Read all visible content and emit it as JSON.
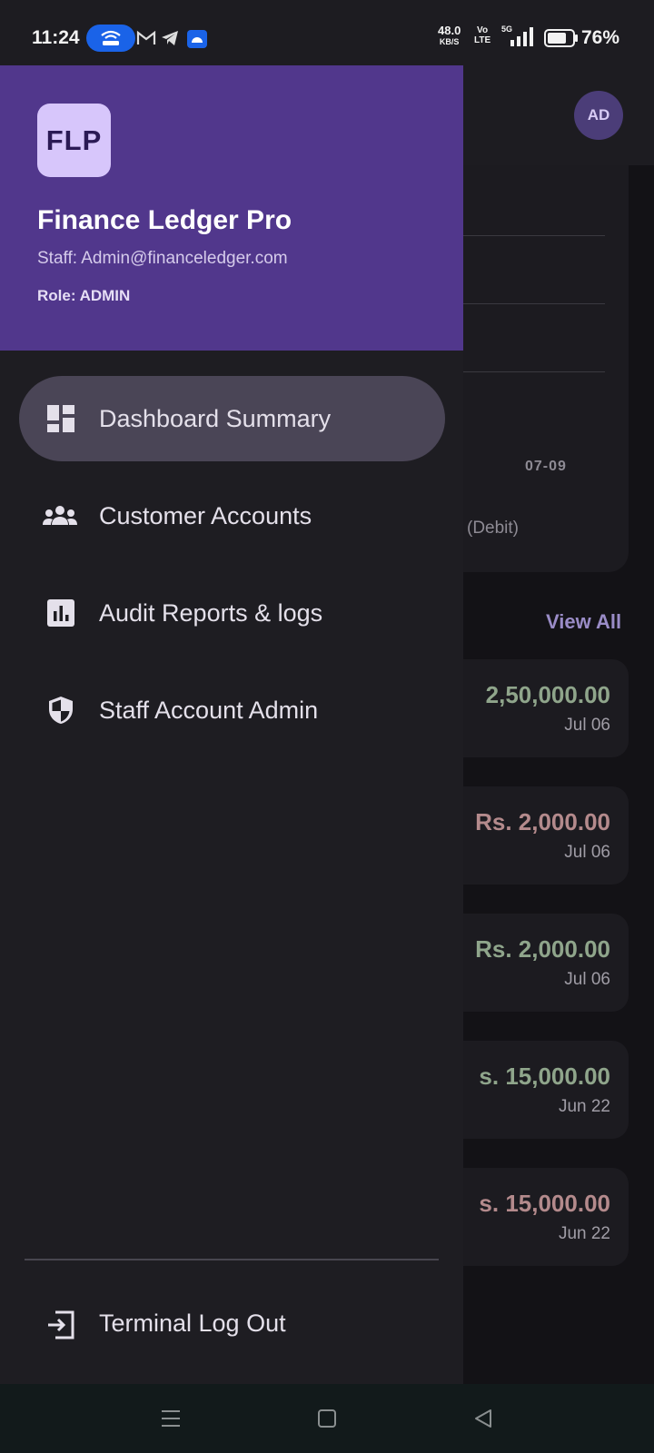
{
  "status_bar": {
    "time": "11:24",
    "net_speed_value": "48.0",
    "net_speed_unit": "KB/S",
    "volte_top": "Vo",
    "volte_bottom": "LTE",
    "network_type": "5G",
    "battery_percent": "76%"
  },
  "drawer": {
    "logo_text": "FLP",
    "app_name": "Finance Ledger Pro",
    "staff_line": "Staff: Admin@financeledger.com",
    "role_line": "Role: ADMIN",
    "nav_items": [
      {
        "label": "Dashboard Summary",
        "icon": "dashboard-icon",
        "active": true
      },
      {
        "label": "Customer Accounts",
        "icon": "group-icon",
        "active": false
      },
      {
        "label": "Audit Reports & logs",
        "icon": "bar-chart-icon",
        "active": false
      },
      {
        "label": "Staff Account Admin",
        "icon": "shield-icon",
        "active": false
      }
    ],
    "logout_label": "Terminal Log Out"
  },
  "background": {
    "avatar_initials": "AD",
    "chart_tick": "07-09",
    "chart_legend": "(Debit)",
    "view_all": "View All",
    "transactions": [
      {
        "amount": "2,50,000.00",
        "date": "Jul 06",
        "kind": "credit"
      },
      {
        "amount": "Rs. 2,000.00",
        "date": "Jul 06",
        "kind": "debit"
      },
      {
        "amount": "Rs. 2,000.00",
        "date": "Jul 06",
        "kind": "credit"
      },
      {
        "amount": "s. 15,000.00",
        "date": "Jun 22",
        "kind": "credit"
      },
      {
        "amount": "s. 15,000.00",
        "date": "Jun 22",
        "kind": "debit"
      }
    ]
  },
  "colors": {
    "header_purple": "#51378c",
    "active_pill": "#4a4556",
    "credit_green": "#8fa58b",
    "debit_red": "#b48a8c"
  }
}
